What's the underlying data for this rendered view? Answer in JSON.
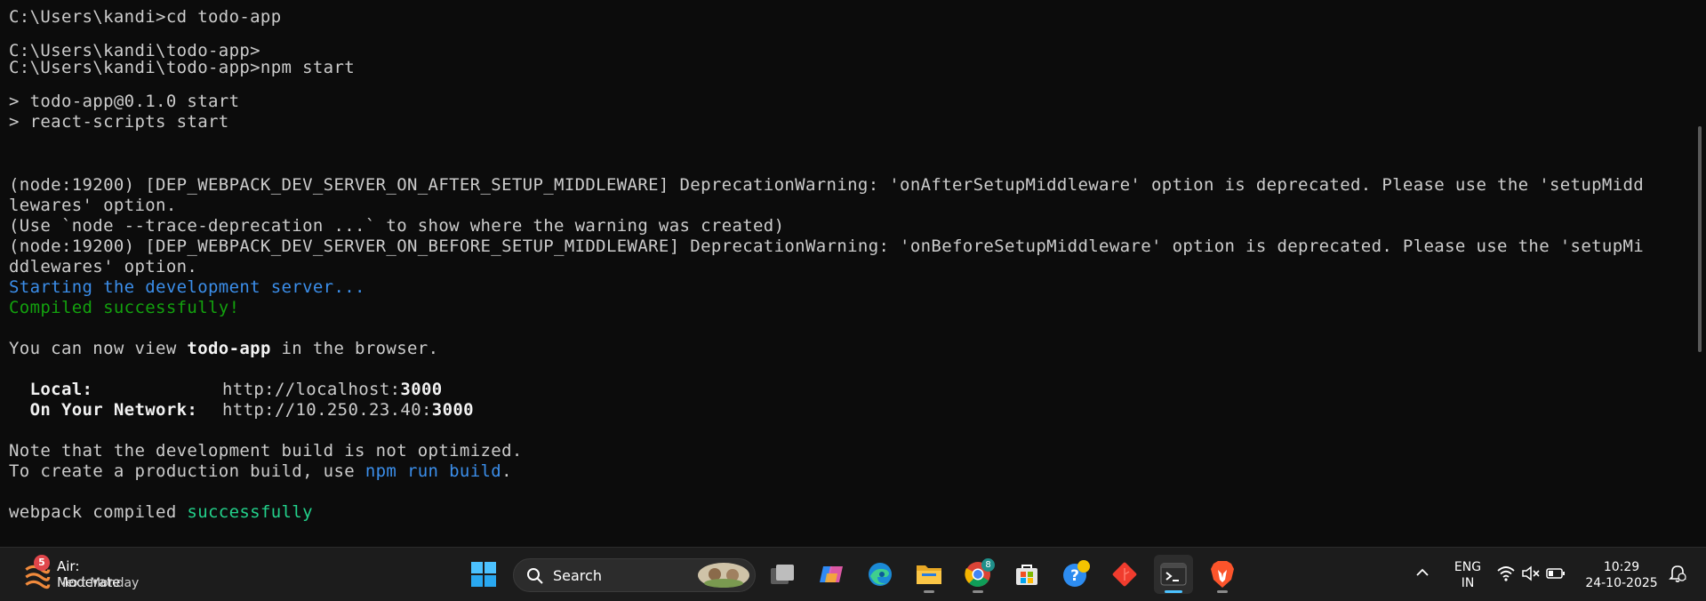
{
  "terminal": {
    "lines": [
      "C:\\Users\\kandi>cd todo-app",
      "",
      "C:\\Users\\kandi\\todo-app>",
      "C:\\Users\\kandi\\todo-app>npm start",
      "",
      "> todo-app@0.1.0 start",
      "> react-scripts start",
      "",
      "(node:19200) [DEP_WEBPACK_DEV_SERVER_ON_AFTER_SETUP_MIDDLEWARE] DeprecationWarning: 'onAfterSetupMiddleware' option is deprecated. Please use the 'setupMidd",
      "lewares' option.",
      "(Use `node --trace-deprecation ...` to show where the warning was created)",
      "(node:19200) [DEP_WEBPACK_DEV_SERVER_ON_BEFORE_SETUP_MIDDLEWARE] DeprecationWarning: 'onBeforeSetupMiddleware' option is deprecated. Please use the 'setupMi",
      "ddlewares' option."
    ],
    "starting": "Starting the development server...",
    "compiled": "Compiled successfully!",
    "view_prefix": "You can now view ",
    "view_app": "todo-app",
    "view_suffix": " in the browser.",
    "local_label": "  Local:",
    "local_url": "http://localhost:",
    "local_port": "3000",
    "network_label": "  On Your Network:",
    "network_url": "http://10.250.23.40:",
    "network_port": "3000",
    "note": "Note that the development build is not optimized.",
    "prod_prefix": "To create a production build, use ",
    "prod_cmd": "npm run build",
    "prod_suffix": ".",
    "webpack_prefix": "webpack compiled ",
    "webpack_status": "successfully"
  },
  "taskbar": {
    "weather": {
      "title": "Air: Moderate",
      "subtitle": "Next Monday",
      "badge": "5",
      "icon": "air-quality-icon"
    },
    "search_label": "Search",
    "apps": [
      {
        "name": "start-button",
        "icon": "windows-logo-icon"
      },
      {
        "name": "task-view",
        "icon": "task-view-icon"
      },
      {
        "name": "copilot",
        "icon": "copilot-icon"
      },
      {
        "name": "edge",
        "icon": "edge-icon"
      },
      {
        "name": "file-explorer",
        "icon": "folder-icon"
      },
      {
        "name": "chrome",
        "icon": "chrome-icon",
        "badge": "8"
      },
      {
        "name": "microsoft-store",
        "icon": "store-icon"
      },
      {
        "name": "help",
        "icon": "help-icon"
      },
      {
        "name": "git",
        "icon": "git-icon"
      },
      {
        "name": "terminal",
        "icon": "terminal-icon"
      },
      {
        "name": "brave",
        "icon": "brave-icon"
      }
    ],
    "language": {
      "line1": "ENG",
      "line2": "IN"
    },
    "clock": {
      "time": "10:29",
      "date": "24-10-2025"
    },
    "colors": {
      "accent": "#4cc2ff",
      "terminal_bg": "#0c0c0c",
      "taskbar_bg": "#1c1c1c",
      "blue_text": "#3b8eea",
      "green_text": "#23d18b"
    }
  }
}
